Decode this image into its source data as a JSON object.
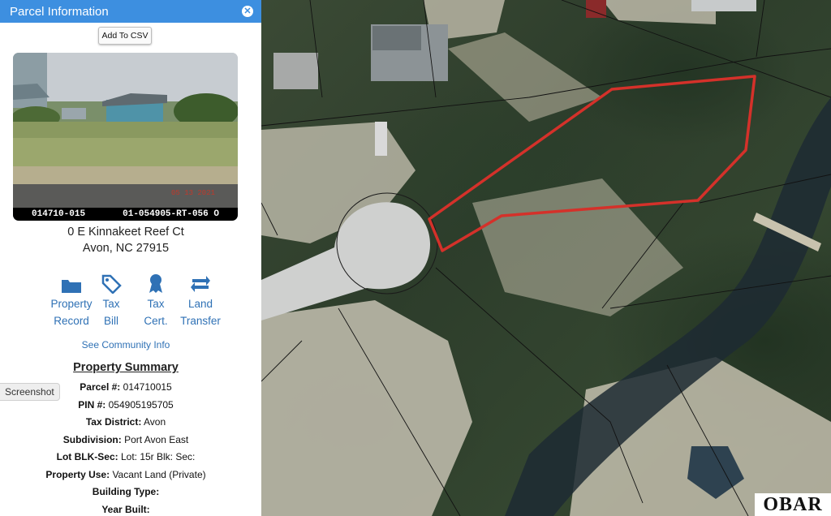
{
  "panel": {
    "title": "Parcel Information",
    "add_csv": "Add To CSV",
    "photo_caption_left": "014710-015",
    "photo_caption_right": "01-054905-RT-056 O",
    "address_line1": "0 E Kinnakeet Reef Ct",
    "address_line2": "Avon, NC 27915",
    "actions": [
      {
        "line1": "Property",
        "line2": "Record",
        "icon": "folder-icon"
      },
      {
        "line1": "Tax",
        "line2": "Bill",
        "icon": "tag-icon"
      },
      {
        "line1": "Tax",
        "line2": "Cert.",
        "icon": "ribbon-icon"
      },
      {
        "line1": "Land",
        "line2": "Transfer",
        "icon": "transfer-icon"
      }
    ],
    "community_link": "See Community Info",
    "summary_title": "Property Summary",
    "summary": [
      {
        "label": "Parcel #:",
        "value": "014710015"
      },
      {
        "label": "PIN #:",
        "value": "054905195705"
      },
      {
        "label": "Tax District:",
        "value": "Avon"
      },
      {
        "label": "Subdivision:",
        "value": "Port Avon East"
      },
      {
        "label": "Lot BLK-Sec:",
        "value": "Lot: 15r Blk: Sec:"
      },
      {
        "label": "Property Use:",
        "value": "Vacant Land (Private)"
      },
      {
        "label": "Building Type:",
        "value": ""
      },
      {
        "label": "Year Built:",
        "value": ""
      }
    ]
  },
  "screenshot_tab": "Screenshot",
  "logo": "OBAR",
  "colors": {
    "header": "#3d8fe0",
    "link": "#2f71b5",
    "parcel_outline": "#d4312a"
  }
}
